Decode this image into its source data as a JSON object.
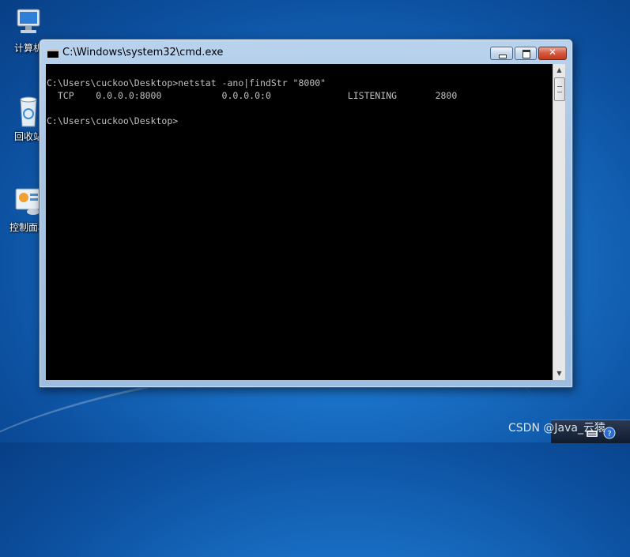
{
  "desktop": {
    "icons": [
      {
        "label": "计算机",
        "icon": "computer-icon"
      },
      {
        "label": "回收站",
        "icon": "recycle-bin-icon"
      },
      {
        "label": "控制面板",
        "icon": "control-panel-icon"
      }
    ],
    "watermark": "CSDN @Java_云猿"
  },
  "window": {
    "title": "C:\\Windows\\system32\\cmd.exe",
    "buttons": {
      "minimize": "minimize",
      "maximize": "maximize",
      "close": "close"
    }
  },
  "console": {
    "text": "C:\\Users\\cuckoo\\Desktop>netstat -ano|findStr \"8000\"\n  TCP    0.0.0.0:8000           0.0.0.0:0              LISTENING       2800\n\nC:\\Users\\cuckoo\\Desktop>"
  },
  "colors": {
    "console_bg": "#000000",
    "console_fg": "#c0c0c0",
    "desktop_blue": "#1a72c8"
  }
}
